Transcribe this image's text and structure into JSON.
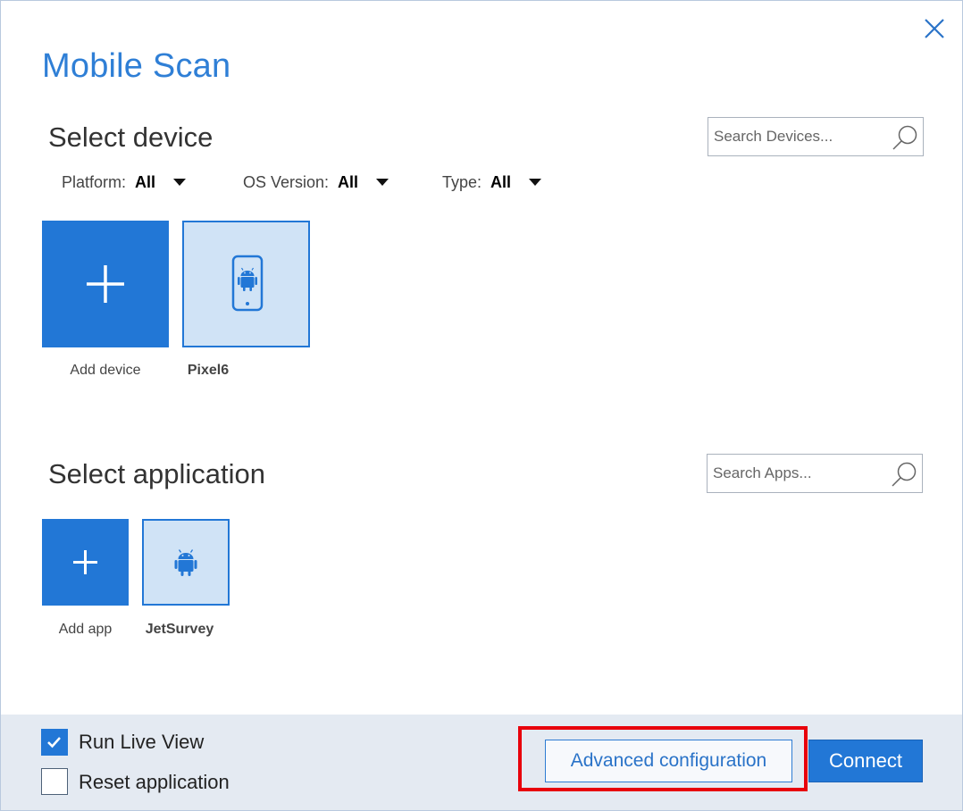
{
  "dialog": {
    "title": "Mobile Scan"
  },
  "devices": {
    "section_title": "Select device",
    "search_placeholder": "Search Devices...",
    "filters": [
      {
        "label": "Platform:",
        "value": "All"
      },
      {
        "label": "OS Version:",
        "value": "All"
      },
      {
        "label": "Type:",
        "value": "All"
      }
    ],
    "add_label": "Add device",
    "items": [
      {
        "name": "Pixel6",
        "icon": "android-phone-icon",
        "selected": true
      }
    ]
  },
  "applications": {
    "section_title": "Select application",
    "search_placeholder": "Search Apps...",
    "add_label": "Add app",
    "items": [
      {
        "name": "JetSurvey",
        "icon": "android-icon",
        "selected": true
      }
    ]
  },
  "footer": {
    "options": [
      {
        "label": "Run Live View",
        "checked": true
      },
      {
        "label": "Reset application",
        "checked": false
      }
    ],
    "advanced_label": "Advanced configuration",
    "connect_label": "Connect"
  },
  "colors": {
    "accent": "#2277d6",
    "title": "#2f7fd6",
    "tile_selected_bg": "#d0e3f6",
    "footer_bg": "#e4eaf2",
    "highlight": "#e8000b"
  }
}
